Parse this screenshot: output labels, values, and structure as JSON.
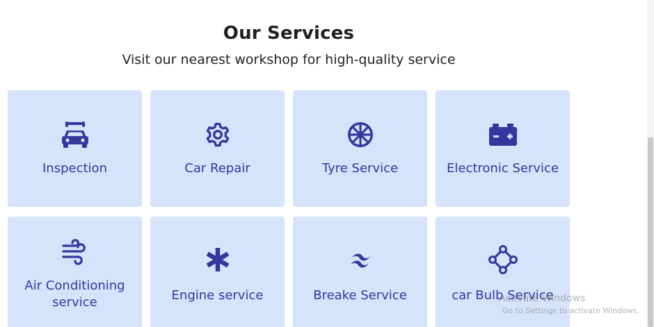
{
  "header": {
    "title": "Our Services",
    "subtitle": "Visit our nearest workshop for high-quality service"
  },
  "services": [
    {
      "label": "Inspection",
      "icon": "car-inspection-icon"
    },
    {
      "label": "Car Repair",
      "icon": "gear-icon"
    },
    {
      "label": "Tyre Service",
      "icon": "tyre-wheel-icon"
    },
    {
      "label": "Electronic Service",
      "icon": "car-battery-icon"
    },
    {
      "label_line1": "Air Conditioning",
      "label_line2": "service",
      "icon": "wind-icon"
    },
    {
      "label": "Engine service",
      "icon": "asterisk-icon"
    },
    {
      "label": "Breake Service",
      "icon": "wave-icon"
    },
    {
      "label": "car Bulb Service",
      "icon": "bulb-diamond-icon"
    }
  ],
  "watermark": {
    "line1": "Activate Windows",
    "line2": "Go to Settings to activate Windows."
  },
  "colors": {
    "card_background": "#d5e3fb",
    "accent": "#34389e",
    "heading": "#1f1f1f"
  }
}
